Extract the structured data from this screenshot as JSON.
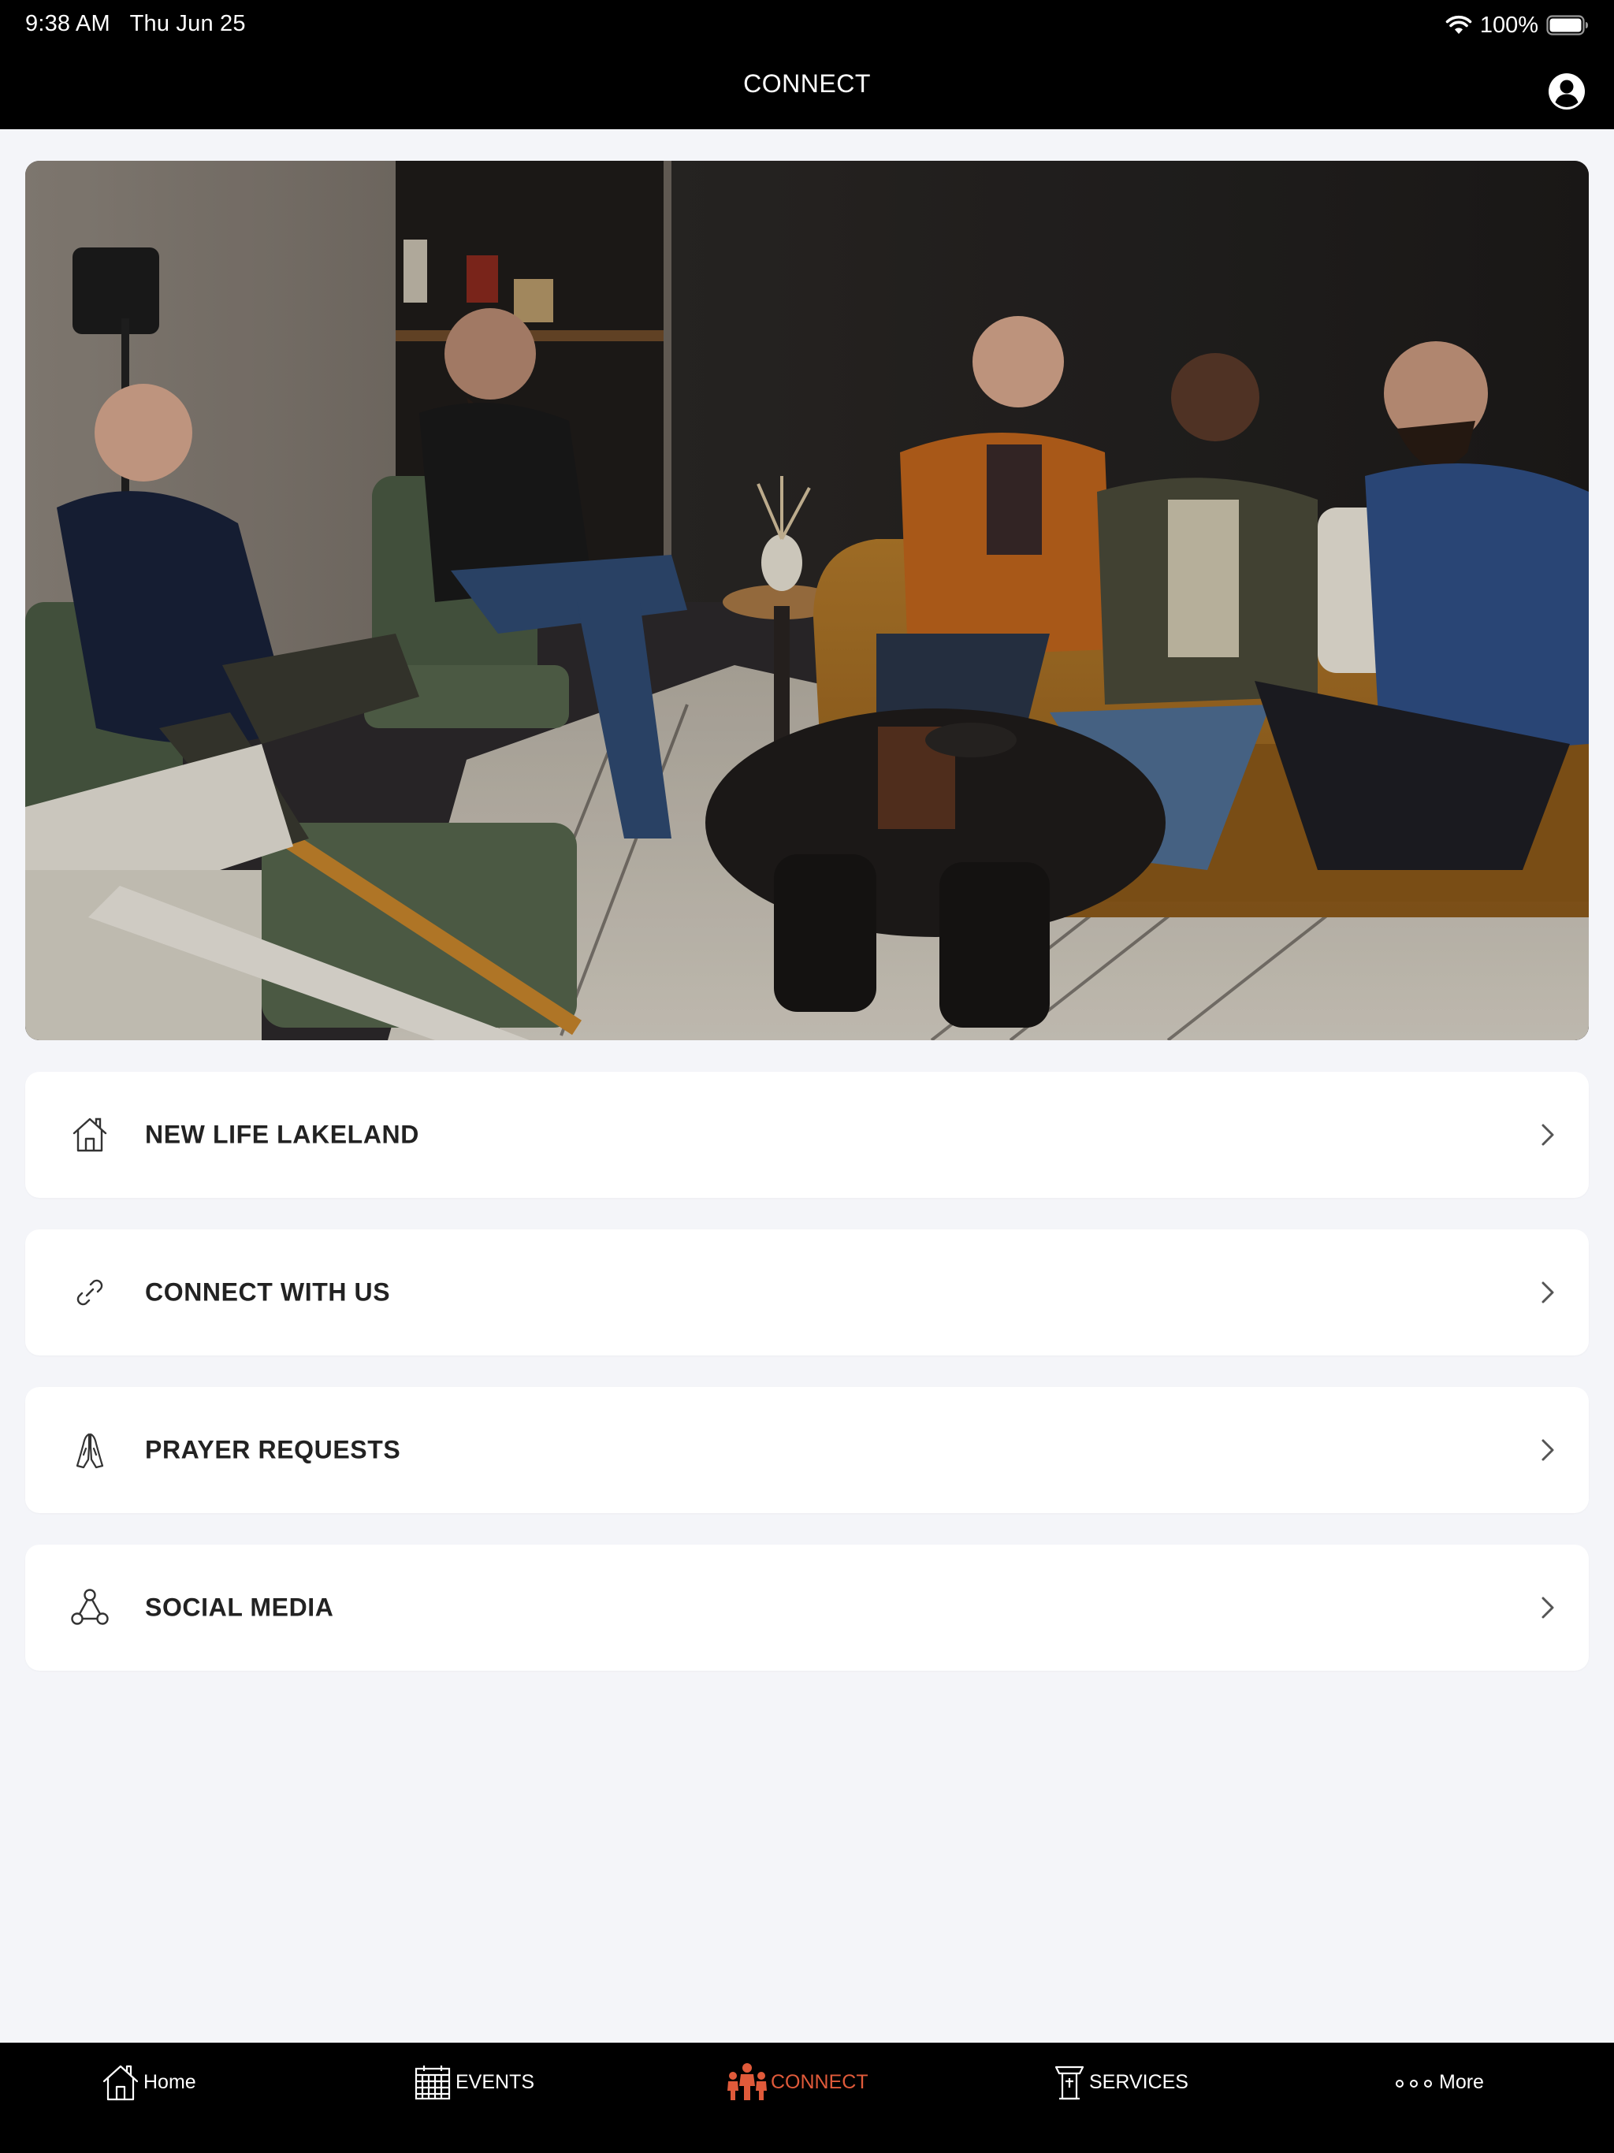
{
  "status_bar": {
    "time": "9:38 AM",
    "date": "Thu Jun 25",
    "battery": "100%"
  },
  "header": {
    "title": "CONNECT"
  },
  "hero": {
    "icon": "group-photo"
  },
  "menu": {
    "items": [
      {
        "label": "NEW LIFE LAKELAND",
        "icon": "home-icon"
      },
      {
        "label": "CONNECT WITH US",
        "icon": "link-icon"
      },
      {
        "label": "PRAYER REQUESTS",
        "icon": "praying-hands-icon"
      },
      {
        "label": "SOCIAL MEDIA",
        "icon": "share-nodes-icon"
      }
    ]
  },
  "tabs": {
    "items": [
      {
        "label": "Home",
        "icon": "home-icon",
        "active": false
      },
      {
        "label": "EVENTS",
        "icon": "calendar-icon",
        "active": false
      },
      {
        "label": "CONNECT",
        "icon": "people-icon",
        "active": true
      },
      {
        "label": "SERVICES",
        "icon": "pulpit-icon",
        "active": false
      },
      {
        "label": "More",
        "icon": "more-dots-icon",
        "active": false
      }
    ]
  },
  "colors": {
    "bar_background": "#000000",
    "page_background": "#f4f5f9",
    "card_background": "#ffffff",
    "accent": "#e05a3a"
  }
}
